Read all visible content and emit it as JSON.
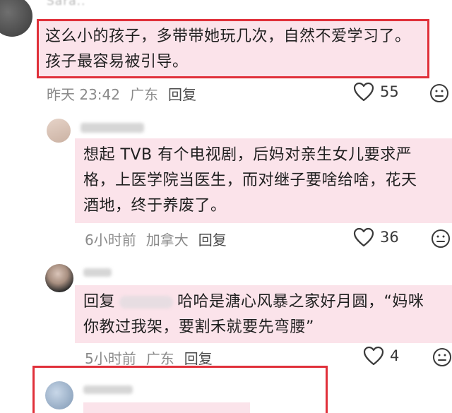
{
  "comments": [
    {
      "username": "Sara..",
      "text_lines": [
        "这么小的孩子，多带带她玩几次，自然不爱学习了。",
        "孩子最容易被引导。"
      ],
      "time": "昨天 23:42",
      "location": "广东",
      "reply_label": "回复",
      "likes": "55"
    },
    {
      "text_lines": [
        "想起 TVB 有个电视剧，后妈对亲生女儿要求严",
        "格，上医学院当医生，而对继子要啥给啥，花天",
        "酒地，终于养废了。"
      ],
      "time": "6小时前",
      "location": "加拿大",
      "reply_label": "回复",
      "likes": "36"
    },
    {
      "line1_prefix": "回复",
      "line1_suffix": "哈哈是溏心风暴之家好月圆，“妈咪",
      "line2": "你教过我架，要割禾就要先弯腰”",
      "time": "5小时前",
      "location": "广东",
      "reply_label": "回复",
      "likes": "4"
    }
  ],
  "colors": {
    "highlight": "#fbe3ea",
    "red_box": "#e0303a",
    "meta_text": "#8a8a8a"
  },
  "icons": {
    "like": "heart-outline-icon",
    "emoji": "neutral-face-icon"
  }
}
